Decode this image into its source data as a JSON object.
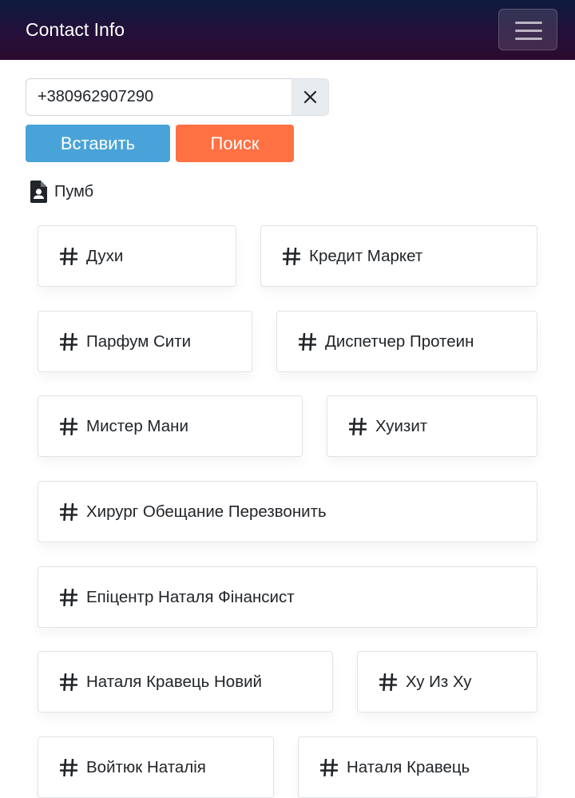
{
  "navbar": {
    "brand": "Contact Info",
    "menu_icon": "hamburger-icon"
  },
  "search": {
    "value": "+380962907290",
    "clear_icon": "close-icon"
  },
  "buttons": {
    "insert_label": "Вставить",
    "search_label": "Поиск",
    "insert_color": "#4aa3d8",
    "search_color": "#ff7043"
  },
  "contact": {
    "icon": "contact-file-icon",
    "name": "Пумб"
  },
  "tags": [
    "Духи",
    "Кредит Маркет",
    "Парфум Сити",
    "Диспетчер Протеин",
    "Мистер Мани",
    "Хуизит",
    "Хирург Обещание Перезвонить",
    "Епіцентр Наталя Фінансист",
    "Наталя Кравець Новий",
    "Ху Из Ху",
    "Войтюк Наталія",
    "Наталя Кравець"
  ]
}
